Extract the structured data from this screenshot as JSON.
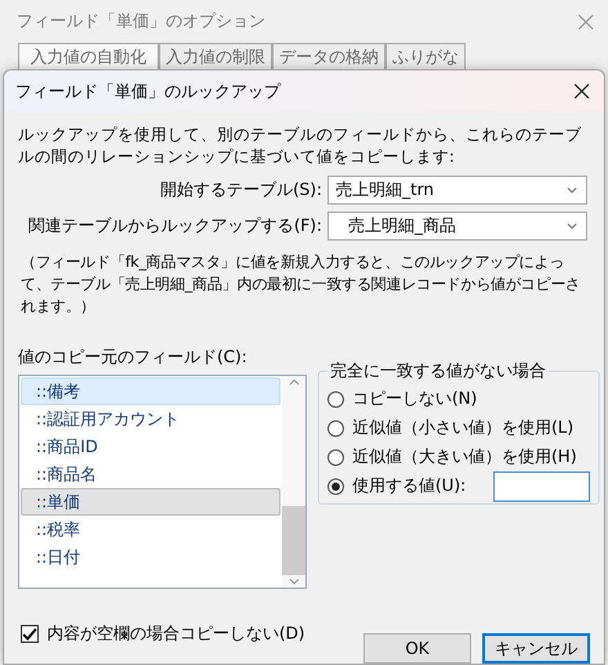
{
  "background_window": {
    "title": "フィールド「単価」のオプション",
    "tabs": [
      {
        "label": "入力値の自動化",
        "selected": true
      },
      {
        "label": "入力値の制限",
        "selected": false
      },
      {
        "label": "データの格納",
        "selected": false
      },
      {
        "label": "ふりがな",
        "selected": false
      }
    ]
  },
  "dialog": {
    "title": "フィールド「単価」のルックアップ",
    "description": "ルックアップを使用して、別のテーブルのフィールドから、これらのテーブルの間のリレーションシップに基づいて値をコピーします:",
    "start_table": {
      "label": "開始するテーブル(S):",
      "value": "売上明細_trn"
    },
    "related_table": {
      "label": "関連テーブルからルックアップする(F):",
      "value": "売上明細_商品"
    },
    "note": "（フィールド「fk_商品マスタ」に値を新規入力すると、このルックアップによって、テーブル「売上明細_商品」内の最初に一致する関連レコードから値がコピーされます。）",
    "source_field_label": "値のコピー元のフィールド(C):",
    "fields": [
      {
        "label": "::備考",
        "selected": false,
        "hovered": true
      },
      {
        "label": "::認証用アカウント",
        "selected": false,
        "hovered": false
      },
      {
        "label": "::商品ID",
        "selected": false,
        "hovered": false
      },
      {
        "label": "::商品名",
        "selected": false,
        "hovered": false
      },
      {
        "label": "::単価",
        "selected": true,
        "hovered": false
      },
      {
        "label": "::税率",
        "selected": false,
        "hovered": false
      },
      {
        "label": "::日付",
        "selected": false,
        "hovered": false
      }
    ],
    "no_match_group": {
      "title": "完全に一致する値がない場合",
      "options": [
        {
          "label": "コピーしない(N)",
          "selected": false
        },
        {
          "label": "近似値（小さい値）を使用(L)",
          "selected": false
        },
        {
          "label": "近似値（大きい値）を使用(H)",
          "selected": false
        },
        {
          "label": "使用する値(U):",
          "selected": true,
          "has_field": true
        }
      ]
    },
    "skip_empty": {
      "label": "内容が空欄の場合コピーしない(D)",
      "checked": true
    },
    "buttons": [
      {
        "label": "OK",
        "default": false
      },
      {
        "label": "キャンセル",
        "default": true
      }
    ]
  }
}
